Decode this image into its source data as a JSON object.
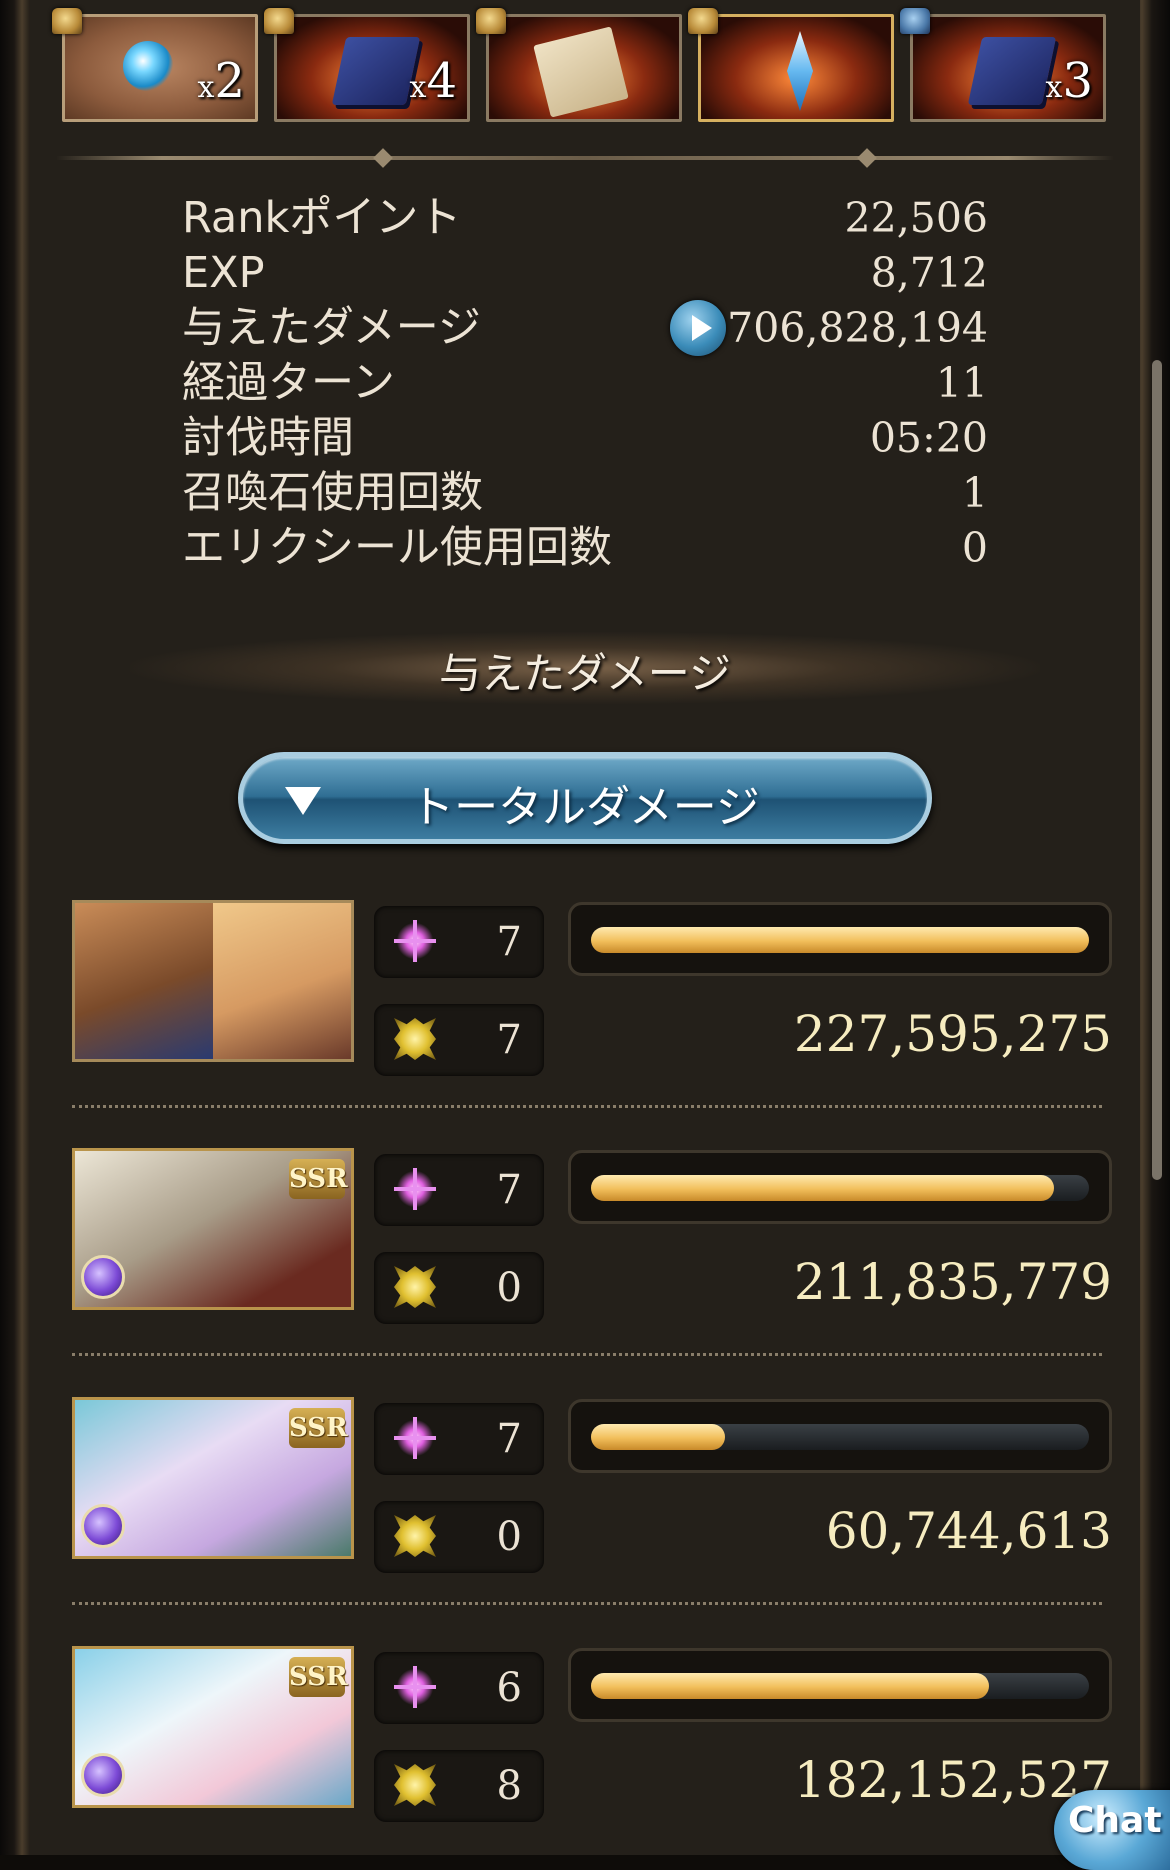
{
  "rewards": [
    {
      "icon": "blue-orb-icon",
      "qty_prefix": "x",
      "qty": "2"
    },
    {
      "icon": "blue-book-icon",
      "qty_prefix": "x",
      "qty": "4"
    },
    {
      "icon": "scroll-icon",
      "qty_prefix": "",
      "qty": ""
    },
    {
      "icon": "crystal-icon",
      "qty_prefix": "",
      "qty": ""
    },
    {
      "icon": "blue-book-icon",
      "qty_prefix": "x",
      "qty": "3"
    }
  ],
  "stats": [
    {
      "label": "Rankポイント",
      "value": "22,506"
    },
    {
      "label": "EXP",
      "value": "8,712"
    },
    {
      "label": "与えたダメージ",
      "value": "706,828,194"
    },
    {
      "label": "経過ターン",
      "value": "11"
    },
    {
      "label": "討伐時間",
      "value": "05:20"
    },
    {
      "label": "召喚石使用回数",
      "value": "1"
    },
    {
      "label": "エリクシール使用回数",
      "value": "0"
    }
  ],
  "section_heading": "与えたダメージ",
  "total_button_label": "トータルダメージ",
  "members": [
    {
      "portrait": "main-characters-portrait",
      "rarity": "",
      "stat_a": "7",
      "stat_b": "7",
      "bar_fraction": 1.0,
      "damage": "227,595,275"
    },
    {
      "portrait": "dark-ssr-character-portrait",
      "rarity": "SSR",
      "stat_a": "7",
      "stat_b": "0",
      "bar_fraction": 0.93,
      "damage": "211,835,779"
    },
    {
      "portrait": "dark-ssr-character-portrait",
      "rarity": "SSR",
      "stat_a": "7",
      "stat_b": "0",
      "bar_fraction": 0.27,
      "damage": "60,744,613"
    },
    {
      "portrait": "dark-ssr-character-portrait",
      "rarity": "SSR",
      "stat_a": "6",
      "stat_b": "8",
      "bar_fraction": 0.8,
      "damage": "182,152,527"
    }
  ],
  "chat_label": "Chat",
  "colors": {
    "bar_fill": "#f1be5a",
    "damage_text": "#f6ecc0",
    "button_blue": "#2f6e93"
  }
}
